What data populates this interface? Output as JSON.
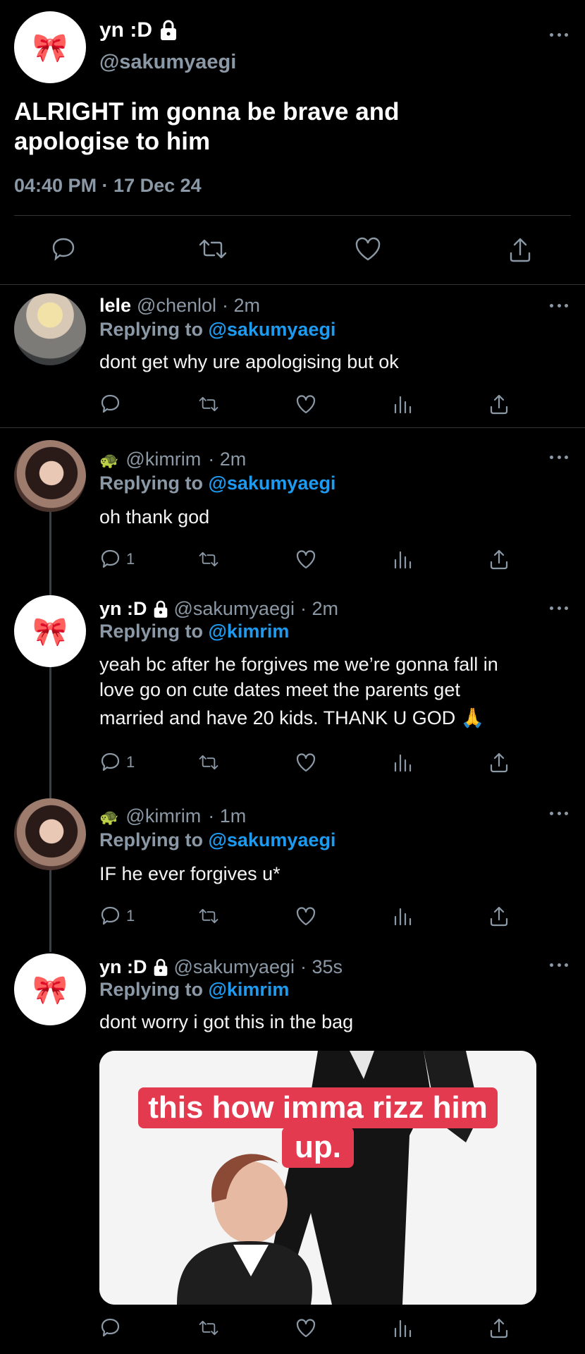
{
  "main_tweet": {
    "display_name": "yn :D",
    "username": "@sakumyaegi",
    "text_line1": "ALRIGHT im gonna be brave and",
    "text_line2": "apologise to him",
    "timestamp": "04:40 PM · 17 Dec 24"
  },
  "replies": [
    {
      "display_name": "lele",
      "username": "@chenlol",
      "time": "· 2m",
      "reply_label": "Replying to",
      "reply_target": "@sakumyaegi",
      "text": "dont get why ure apologising but ok",
      "reply_count": ""
    },
    {
      "display_name": "🐢",
      "username": "@kimrim",
      "time": "· 2m",
      "reply_label": "Replying to",
      "reply_target": "@sakumyaegi",
      "text": "oh thank god",
      "reply_count": "1"
    },
    {
      "display_name": "yn :D",
      "username": "@sakumyaegi",
      "time": "· 2m",
      "reply_label": "Replying to",
      "reply_target": "@kimrim",
      "text_line1": "yeah bc after he forgives me we’re gonna fall in",
      "text_line2": "love go on cute dates meet the parents get",
      "text_line3": "married and have 20 kids. THANK U GOD 🙏",
      "reply_count": "1"
    },
    {
      "display_name": "🐢",
      "username": "@kimrim",
      "time": "· 1m",
      "reply_label": "Replying to",
      "reply_target": "@sakumyaegi",
      "text": "IF he ever forgives u*",
      "reply_count": "1"
    },
    {
      "display_name": "yn :D",
      "username": "@sakumyaegi",
      "time": "· 35s",
      "reply_label": "Replying to",
      "reply_target": "@kimrim",
      "text": "dont worry i got this in the bag",
      "reply_count": "",
      "image_caption_line1": "this how imma rizz him",
      "image_caption_line2": "up."
    }
  ],
  "icons": {
    "avatar_emoji": "🎀",
    "lock": "lock-icon",
    "reply": "reply-icon",
    "retweet": "retweet-icon",
    "like": "heart-icon",
    "views": "views-icon",
    "share": "share-icon"
  },
  "colors": {
    "background": "#000000",
    "link": "#1d9bf0",
    "muted": "#8b98a5",
    "text": "#ffffff"
  }
}
